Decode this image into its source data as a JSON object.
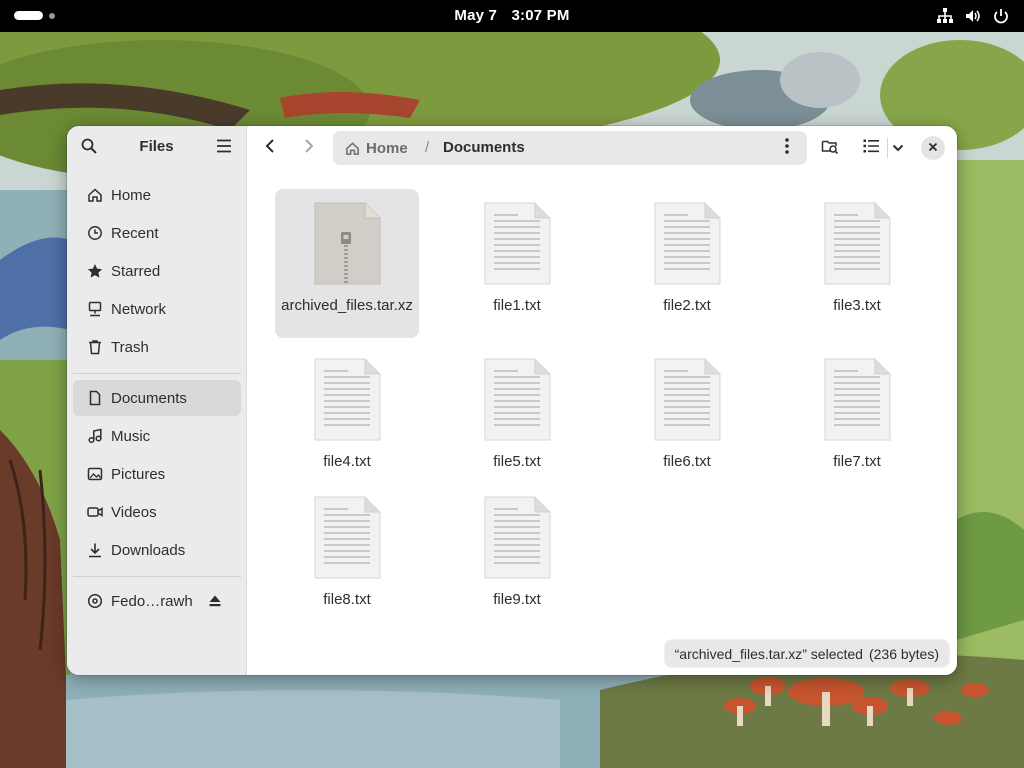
{
  "topbar": {
    "date": "May 7",
    "time": "3:07 PM",
    "icons": [
      "network-icon",
      "volume-icon",
      "power-icon"
    ]
  },
  "sidebar": {
    "title": "Files",
    "places": [
      {
        "label": "Home",
        "icon": "home-icon"
      },
      {
        "label": "Recent",
        "icon": "clock-icon"
      },
      {
        "label": "Starred",
        "icon": "star-icon"
      },
      {
        "label": "Network",
        "icon": "network-icon"
      },
      {
        "label": "Trash",
        "icon": "trash-icon"
      }
    ],
    "bookmarks": [
      {
        "label": "Documents",
        "icon": "document-icon",
        "active": true
      },
      {
        "label": "Music",
        "icon": "music-icon"
      },
      {
        "label": "Pictures",
        "icon": "picture-icon"
      },
      {
        "label": "Videos",
        "icon": "video-icon"
      },
      {
        "label": "Downloads",
        "icon": "download-icon"
      }
    ],
    "devices": [
      {
        "label": "Fedo…rawh",
        "icon": "disc-icon"
      }
    ]
  },
  "pathbar": {
    "home": "Home",
    "separator": "/",
    "current": "Documents"
  },
  "files": [
    {
      "name": "archived_files.tar.xz",
      "type": "archive",
      "selected": true
    },
    {
      "name": "file1.txt",
      "type": "text"
    },
    {
      "name": "file2.txt",
      "type": "text"
    },
    {
      "name": "file3.txt",
      "type": "text"
    },
    {
      "name": "file4.txt",
      "type": "text"
    },
    {
      "name": "file5.txt",
      "type": "text"
    },
    {
      "name": "file6.txt",
      "type": "text"
    },
    {
      "name": "file7.txt",
      "type": "text"
    },
    {
      "name": "file8.txt",
      "type": "text"
    },
    {
      "name": "file9.txt",
      "type": "text"
    }
  ],
  "status": {
    "selection": "“archived_files.tar.xz” selected",
    "size": "(236 bytes)"
  },
  "colors": {
    "topbar": "#000000",
    "sidebar": "#ebebed",
    "selection": "#e4e4e6",
    "text": "#2e2e2e"
  }
}
